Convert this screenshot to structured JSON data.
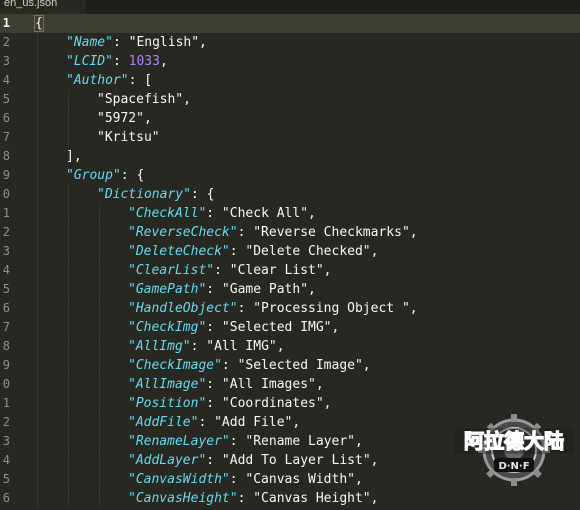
{
  "tab": {
    "title": "en_us.json"
  },
  "editor": {
    "current_line": 0,
    "lines": [
      {
        "no": "1",
        "indent": 0,
        "parts": [
          {
            "t": "{",
            "c": "brace-open"
          }
        ]
      },
      {
        "no": "2",
        "indent": 1,
        "parts": [
          {
            "t": "\"Name\"",
            "c": "k"
          },
          {
            "t": ": \"English\",",
            "c": "p"
          }
        ]
      },
      {
        "no": "3",
        "indent": 1,
        "parts": [
          {
            "t": "\"LCID\"",
            "c": "k"
          },
          {
            "t": ": ",
            "c": "p"
          },
          {
            "t": "1033",
            "c": "n"
          },
          {
            "t": ",",
            "c": "p"
          }
        ]
      },
      {
        "no": "4",
        "indent": 1,
        "parts": [
          {
            "t": "\"Author\"",
            "c": "k"
          },
          {
            "t": ": [",
            "c": "p"
          }
        ]
      },
      {
        "no": "5",
        "indent": 2,
        "parts": [
          {
            "t": "\"Spacefish\",",
            "c": "p"
          }
        ]
      },
      {
        "no": "6",
        "indent": 2,
        "parts": [
          {
            "t": "\"5972\",",
            "c": "p"
          }
        ]
      },
      {
        "no": "7",
        "indent": 2,
        "parts": [
          {
            "t": "\"Kritsu\"",
            "c": "p"
          }
        ]
      },
      {
        "no": "8",
        "indent": 1,
        "parts": [
          {
            "t": "],",
            "c": "p"
          }
        ]
      },
      {
        "no": "9",
        "indent": 1,
        "parts": [
          {
            "t": "\"Group\"",
            "c": "k"
          },
          {
            "t": ": {",
            "c": "p"
          }
        ]
      },
      {
        "no": "0",
        "indent": 2,
        "parts": [
          {
            "t": "\"Dictionary\"",
            "c": "k"
          },
          {
            "t": ": {",
            "c": "p"
          }
        ]
      },
      {
        "no": "1",
        "indent": 3,
        "parts": [
          {
            "t": "\"CheckAll\"",
            "c": "k"
          },
          {
            "t": ": \"Check All\",",
            "c": "p"
          }
        ]
      },
      {
        "no": "2",
        "indent": 3,
        "parts": [
          {
            "t": "\"ReverseCheck\"",
            "c": "k"
          },
          {
            "t": ": \"Reverse Checkmarks\",",
            "c": "p"
          }
        ]
      },
      {
        "no": "3",
        "indent": 3,
        "parts": [
          {
            "t": "\"DeleteCheck\"",
            "c": "k"
          },
          {
            "t": ": \"Delete Checked\",",
            "c": "p"
          }
        ]
      },
      {
        "no": "4",
        "indent": 3,
        "parts": [
          {
            "t": "\"ClearList\"",
            "c": "k"
          },
          {
            "t": ": \"Clear List\",",
            "c": "p"
          }
        ]
      },
      {
        "no": "5",
        "indent": 3,
        "parts": [
          {
            "t": "\"GamePath\"",
            "c": "k"
          },
          {
            "t": ": \"Game Path\",",
            "c": "p"
          }
        ]
      },
      {
        "no": "6",
        "indent": 3,
        "parts": [
          {
            "t": "\"HandleObject\"",
            "c": "k"
          },
          {
            "t": ": \"Processing Object \",",
            "c": "p"
          }
        ]
      },
      {
        "no": "7",
        "indent": 3,
        "parts": [
          {
            "t": "\"CheckImg\"",
            "c": "k"
          },
          {
            "t": ": \"Selected IMG\",",
            "c": "p"
          }
        ]
      },
      {
        "no": "8",
        "indent": 3,
        "parts": [
          {
            "t": "\"AllImg\"",
            "c": "k"
          },
          {
            "t": ": \"All IMG\",",
            "c": "p"
          }
        ]
      },
      {
        "no": "9",
        "indent": 3,
        "parts": [
          {
            "t": "\"CheckImage\"",
            "c": "k"
          },
          {
            "t": ": \"Selected Image\",",
            "c": "p"
          }
        ]
      },
      {
        "no": "0",
        "indent": 3,
        "parts": [
          {
            "t": "\"AllImage\"",
            "c": "k"
          },
          {
            "t": ": \"All Images\",",
            "c": "p"
          }
        ]
      },
      {
        "no": "1",
        "indent": 3,
        "parts": [
          {
            "t": "\"Position\"",
            "c": "k"
          },
          {
            "t": ": \"Coordinates\",",
            "c": "p"
          }
        ]
      },
      {
        "no": "2",
        "indent": 3,
        "parts": [
          {
            "t": "\"AddFile\"",
            "c": "k"
          },
          {
            "t": ": \"Add File\",",
            "c": "p"
          }
        ]
      },
      {
        "no": "3",
        "indent": 3,
        "parts": [
          {
            "t": "\"RenameLayer\"",
            "c": "k"
          },
          {
            "t": ": \"Rename Layer\",",
            "c": "p"
          }
        ]
      },
      {
        "no": "4",
        "indent": 3,
        "parts": [
          {
            "t": "\"AddLayer\"",
            "c": "k"
          },
          {
            "t": ": \"Add To Layer List\",",
            "c": "p"
          }
        ]
      },
      {
        "no": "5",
        "indent": 3,
        "parts": [
          {
            "t": "\"CanvasWidth\"",
            "c": "k"
          },
          {
            "t": ": \"Canvas Width\",",
            "c": "p"
          }
        ]
      },
      {
        "no": "6",
        "indent": 3,
        "parts": [
          {
            "t": "\"CanvasHeight\"",
            "c": "k"
          },
          {
            "t": ": \"Canvas Height\",",
            "c": "p"
          }
        ]
      }
    ]
  },
  "watermark": {
    "icon": "dnf-logo-icon",
    "title_text": "阿拉德大陆",
    "sub_text": "D·N·F"
  },
  "colors": {
    "background": "#272822",
    "key": "#66d9ef",
    "text": "#f8f8f2",
    "number": "#ae81ff",
    "line_number": "#90908a"
  }
}
